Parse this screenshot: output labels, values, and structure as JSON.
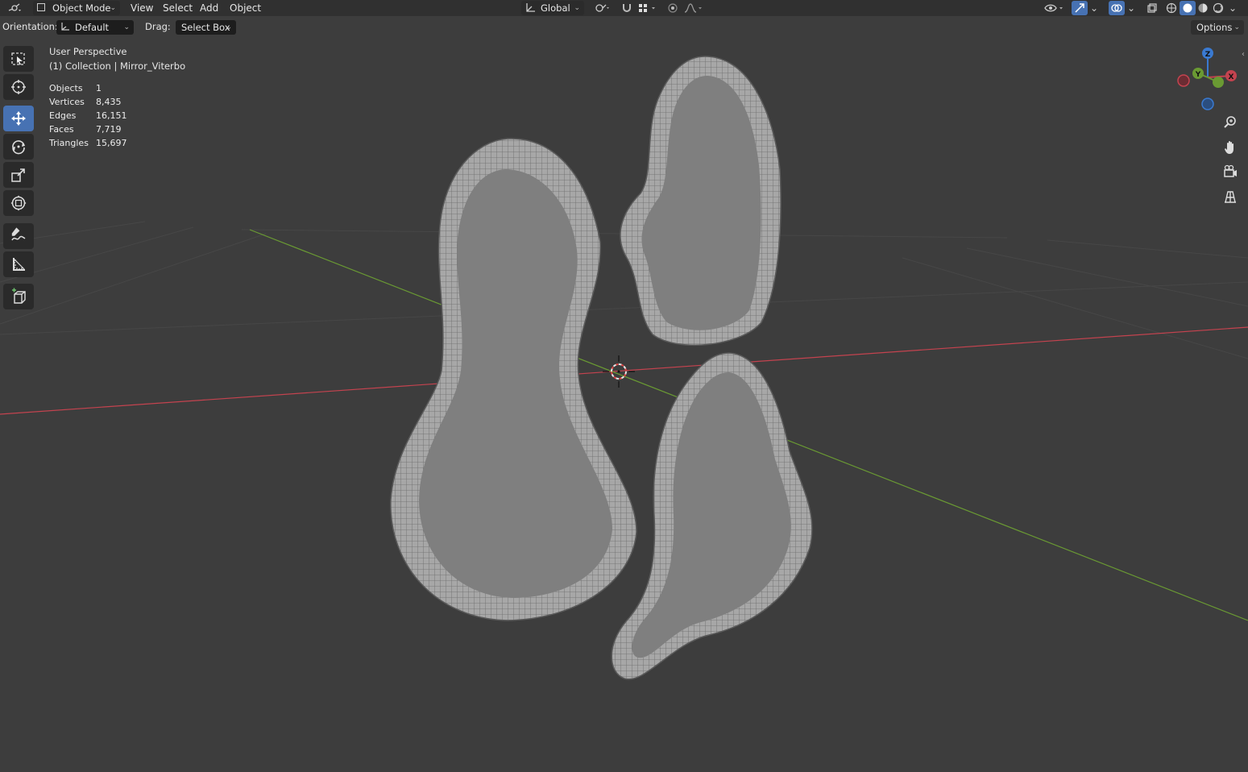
{
  "header": {
    "mode_label": "Object Mode",
    "menus": [
      "View",
      "Select",
      "Add",
      "Object"
    ],
    "transform_orientation": "Global"
  },
  "tool_settings": {
    "orientation_label": "Orientation:",
    "orientation_value": "Default",
    "drag_label": "Drag:",
    "drag_value": "Select Box",
    "options_label": "Options"
  },
  "overlay": {
    "view_name": "User Perspective",
    "collection_line": "(1) Collection | Mirror_Viterbo",
    "stats": [
      {
        "label": "Objects",
        "value": "1"
      },
      {
        "label": "Vertices",
        "value": "8,435"
      },
      {
        "label": "Edges",
        "value": "16,151"
      },
      {
        "label": "Faces",
        "value": "7,719"
      },
      {
        "label": "Triangles",
        "value": "15,697"
      }
    ]
  },
  "gizmo": {
    "z": "Z",
    "y": "Y",
    "x": "X"
  },
  "toolbar": {
    "tools": [
      "select-box",
      "cursor",
      "move",
      "rotate",
      "scale",
      "transform",
      "annotate",
      "measure",
      "add-cube"
    ],
    "active_tool": "move"
  },
  "colors": {
    "background": "#3d3d3d",
    "header": "#303030",
    "active_tool": "#4772b3",
    "x_axis": "#c4434f",
    "y_axis": "#6a9a33",
    "z_axis": "#3a7ad1"
  }
}
